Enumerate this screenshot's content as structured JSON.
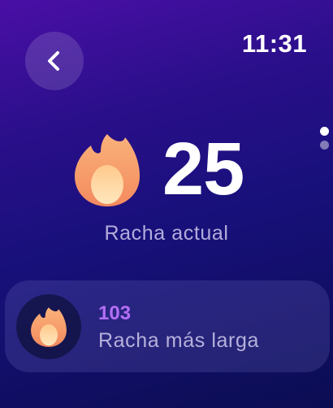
{
  "status_bar": {
    "time": "11:31"
  },
  "nav": {
    "back_icon": "chevron-left-icon"
  },
  "current_streak": {
    "value": "25",
    "label": "Racha actual",
    "icon": "flame-icon"
  },
  "longest_streak": {
    "value": "103",
    "label": "Racha más larga",
    "icon": "flame-icon"
  },
  "pager": {
    "pages": 2,
    "active_index": 0
  },
  "colors": {
    "accent_purple": "#b46ef5",
    "flame_outer": "#f7a06a",
    "flame_inner": "#ffd7a3"
  }
}
